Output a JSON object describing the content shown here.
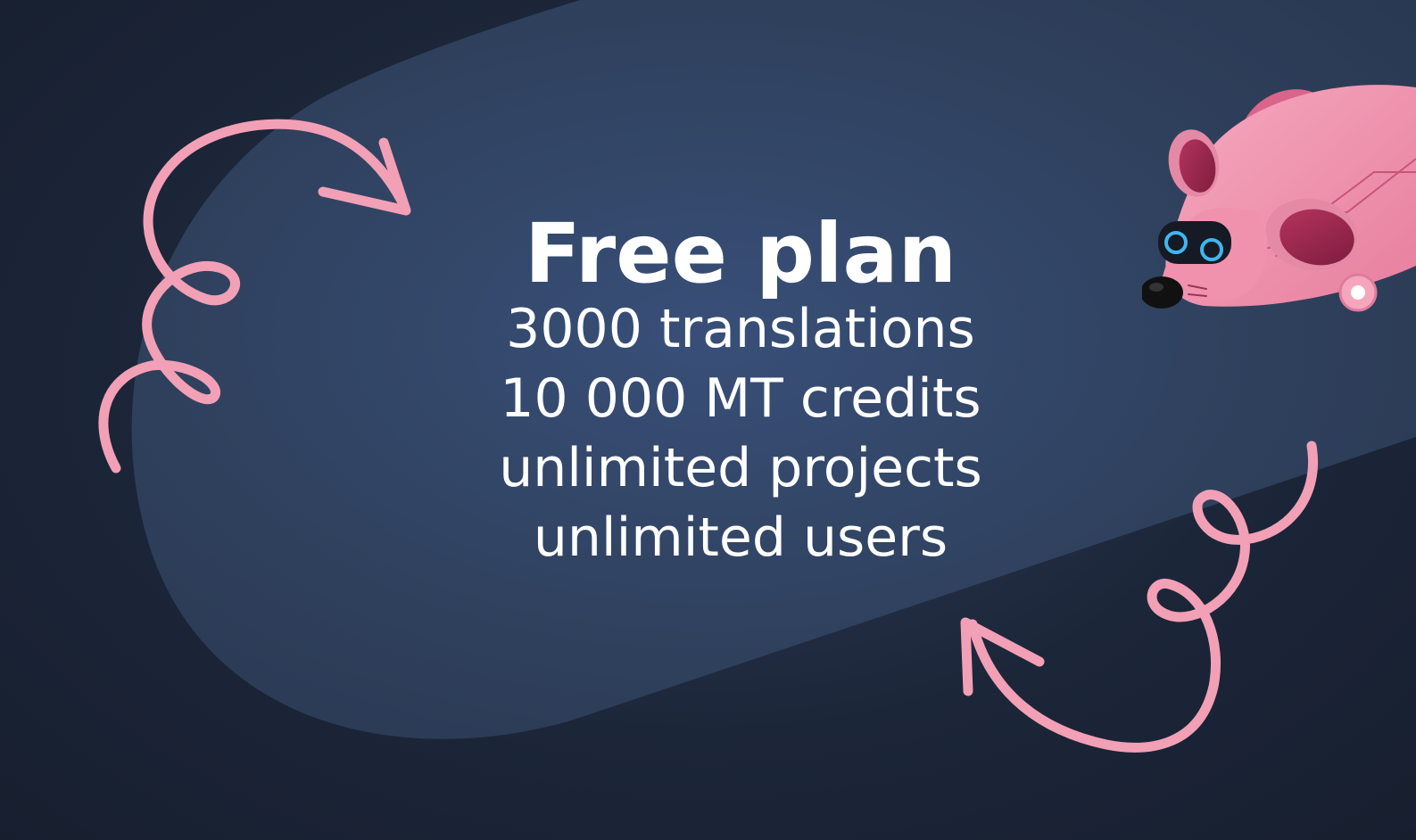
{
  "heading": {
    "title": "Free plan"
  },
  "features": [
    "3000 translations",
    "10 000 MT credits",
    "unlimited projects",
    "unlimited users"
  ],
  "decorations": {
    "squiggle_arrow_icon": "squiggle-arrow-icon",
    "mascot_icon": "robot-mouse-icon"
  },
  "colors": {
    "background": "#1a2335",
    "blob": "#34476a",
    "accent_pink": "#f2a0b6",
    "text": "#ffffff"
  }
}
